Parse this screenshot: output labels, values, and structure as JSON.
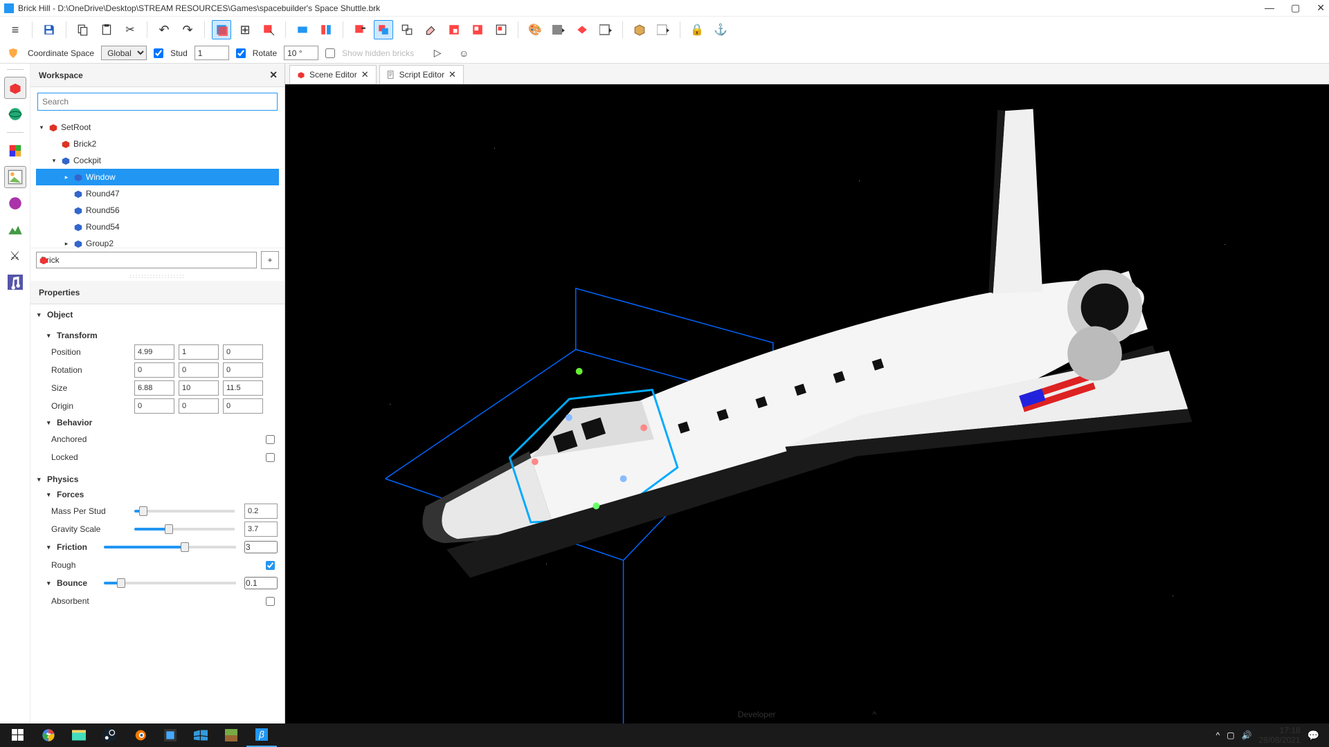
{
  "window": {
    "title": "Brick Hill - D:\\OneDrive\\Desktop\\STREAM RESOURCES\\Games\\spacebuilder's Space Shuttle.brk"
  },
  "subbar": {
    "coord_label": "Coordinate Space",
    "coord_value": "Global",
    "stud_label": "Stud",
    "stud_value": "1",
    "rotate_label": "Rotate",
    "rotate_value": "10 °",
    "show_hidden": "Show hidden bricks"
  },
  "workspace": {
    "title": "Workspace",
    "search_placeholder": "Search",
    "tree": [
      {
        "label": "SetRoot",
        "indent": 0,
        "arrow": "▾",
        "icon": "#d32"
      },
      {
        "label": "Brick2",
        "indent": 1,
        "arrow": "",
        "icon": "#d32"
      },
      {
        "label": "Cockpit",
        "indent": 1,
        "arrow": "▾",
        "icon": "#36c"
      },
      {
        "label": "Window",
        "indent": 2,
        "arrow": "▸",
        "icon": "#36c",
        "sel": true
      },
      {
        "label": "Round47",
        "indent": 2,
        "arrow": "",
        "icon": "#36c"
      },
      {
        "label": "Round56",
        "indent": 2,
        "arrow": "",
        "icon": "#36c"
      },
      {
        "label": "Round54",
        "indent": 2,
        "arrow": "",
        "icon": "#36c"
      },
      {
        "label": "Group2",
        "indent": 2,
        "arrow": "▸",
        "icon": "#36c"
      }
    ],
    "add_value": "Brick",
    "add_btn": "+"
  },
  "properties": {
    "title": "Properties",
    "object": {
      "label": "Object"
    },
    "transform": {
      "label": "Transform",
      "position": {
        "label": "Position",
        "x": "4.99",
        "y": "1",
        "z": "0"
      },
      "rotation": {
        "label": "Rotation",
        "x": "0",
        "y": "0",
        "z": "0"
      },
      "size": {
        "label": "Size",
        "x": "6.88",
        "y": "10",
        "z": "11.5"
      },
      "origin": {
        "label": "Origin",
        "x": "0",
        "y": "0",
        "z": "0"
      }
    },
    "behavior": {
      "label": "Behavior",
      "anchored": "Anchored",
      "locked": "Locked"
    },
    "physics": {
      "label": "Physics"
    },
    "forces": {
      "label": "Forces",
      "mass": {
        "label": "Mass Per Stud",
        "value": "0.2",
        "pct": 5
      },
      "gravity": {
        "label": "Gravity Scale",
        "value": "3.7",
        "pct": 30
      },
      "friction": {
        "label": "Friction",
        "value": "3",
        "pct": 58
      },
      "rough": {
        "label": "Rough",
        "checked": true
      },
      "bounce": {
        "label": "Bounce",
        "value": "0.1",
        "pct": 10
      },
      "absorbent": {
        "label": "Absorbent",
        "checked": false
      }
    }
  },
  "tabs": [
    {
      "label": "Scene Editor"
    },
    {
      "label": "Script Editor"
    }
  ],
  "developer_label": "Developer",
  "taskbar": {
    "time": "17:18",
    "date": "28/08/2021"
  }
}
